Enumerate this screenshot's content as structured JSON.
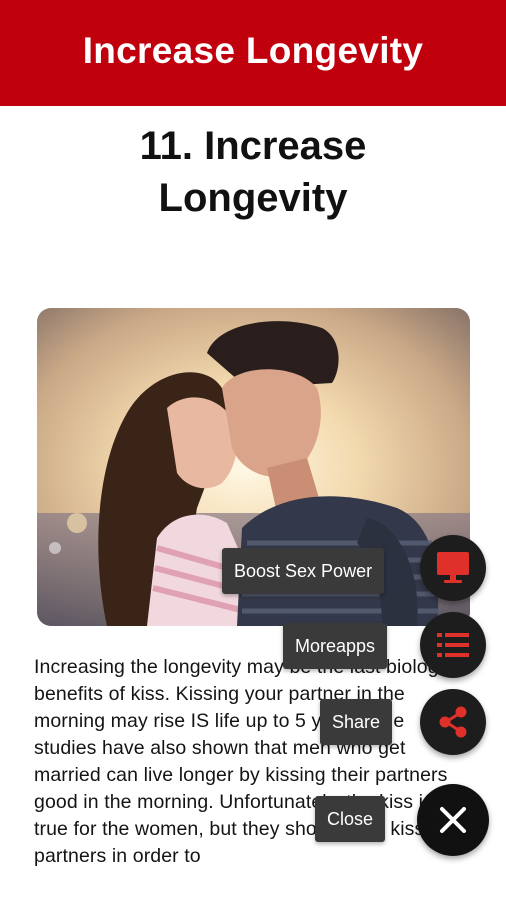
{
  "app_bar": {
    "title": "Increase Longevity"
  },
  "heading": {
    "line1": "11.  Increase",
    "line2": "Longevity"
  },
  "article": {
    "text": "Increasing the longevity may be the last biological benefits of kiss. Kissing your partner in the morning may rise IS life up to 5 years. The studies have also shown that men who get married can live longer by kissing their partners good in the morning. Unfortunately, the kiss is not true for the women, but they should also kiss their partners in order to"
  },
  "fab_menu": {
    "items": [
      {
        "label": "Boost Sex Power",
        "icon": "monitor-icon"
      },
      {
        "label": "Moreapps",
        "icon": "list-icon"
      },
      {
        "label": "Share",
        "icon": "share-icon"
      },
      {
        "label": "Close",
        "icon": "close-icon"
      }
    ]
  },
  "colors": {
    "app_bar": "#c0000d",
    "fab_icon_accent": "#e0302a",
    "fab_background": "#1d1d1d"
  }
}
